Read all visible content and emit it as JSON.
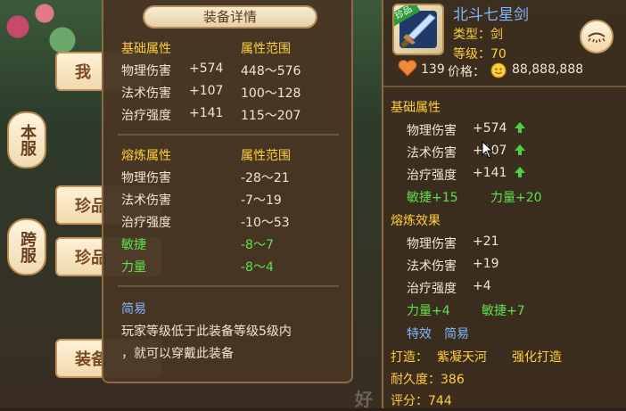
{
  "background": {
    "side_tabs": [
      "本服",
      "跨服"
    ],
    "left_buttons": [
      "珍品",
      "珍品",
      "装备"
    ],
    "partial_labels": [
      "我",
      "好"
    ]
  },
  "detail": {
    "title": "装备详情",
    "base_section": {
      "header_left": "基础属性",
      "header_right": "属性范围",
      "rows": [
        {
          "name": "物理伤害",
          "value": "+574",
          "range": "448～576"
        },
        {
          "name": "法术伤害",
          "value": "+107",
          "range": "100～128"
        },
        {
          "name": "治疗强度",
          "value": "+141",
          "range": "115～207"
        }
      ]
    },
    "refine_section": {
      "header_left": "熔炼属性",
      "header_right": "属性范围",
      "rows": [
        {
          "name": "物理伤害",
          "range": "-28～21",
          "color": "#f1e6cf"
        },
        {
          "name": "法术伤害",
          "range": "-7～19",
          "color": "#f1e6cf"
        },
        {
          "name": "治疗强度",
          "range": "-10～53",
          "color": "#f1e6cf"
        },
        {
          "name": "敏捷",
          "range": "-8～7",
          "color": "#5fe04f"
        },
        {
          "name": "力量",
          "range": "-8～4",
          "color": "#5fe04f"
        }
      ]
    },
    "easy": {
      "label": "简易",
      "line1": "玩家等级低于此装备等级5级内",
      "line2": "，就可以穿戴此装备"
    }
  },
  "item": {
    "badge": "珍品",
    "name": "北斗七星剑",
    "type_line": "类型：剑",
    "level_line": "等级：70",
    "likes": "139",
    "price_label": "价格：",
    "price_value": "88,888,888",
    "base_header": "基础属性",
    "base_rows": [
      {
        "name": "物理伤害",
        "value": "+574"
      },
      {
        "name": "法术伤害",
        "value": "+107"
      },
      {
        "name": "治疗强度",
        "value": "+141"
      }
    ],
    "extra_a": "敏捷+15",
    "extra_b": "力量+20",
    "refine_header": "熔炼效果",
    "refine_rows": [
      {
        "name": "物理伤害",
        "value": "+21"
      },
      {
        "name": "法术伤害",
        "value": "+19"
      },
      {
        "name": "治疗强度",
        "value": "+4"
      }
    ],
    "refine_extra_a": "力量+4",
    "refine_extra_b": "敏捷+7",
    "effect_label": "特效",
    "effect_value": "简易",
    "forge_label": "打造：",
    "forge_value": "紫凝天河",
    "forge_extra": "强化打造",
    "durability": "耐久度：386",
    "score": "评分：744"
  },
  "colors": {
    "gold": "#ffcf3c",
    "green": "#5fe04f",
    "name_blue": "#7fb8ff"
  }
}
